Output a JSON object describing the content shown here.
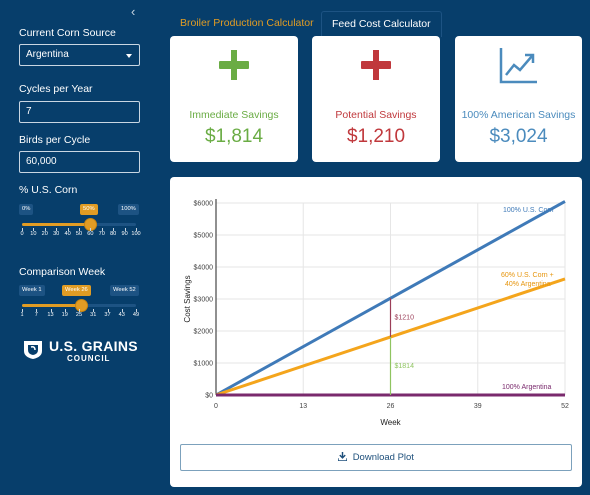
{
  "sidebar": {
    "collapse_glyph": "‹",
    "corn_source_label": "Current Corn Source",
    "corn_source_value": "Argentina",
    "cycles_label": "Cycles per Year",
    "cycles_value": "7",
    "birds_label": "Birds per Cycle",
    "birds_value": "60,000",
    "pct_label": "% U.S. Corn",
    "pct_presets": [
      "0%",
      "50%",
      "100%"
    ],
    "pct_ticks": [
      "0",
      "10",
      "20",
      "30",
      "40",
      "50",
      "60",
      "70",
      "80",
      "90",
      "100"
    ],
    "pct_value": 60,
    "week_label": "Comparison Week",
    "week_presets": [
      "Week 1",
      "Week 26",
      "Week 52"
    ],
    "week_ticks": [
      "1",
      "7",
      "13",
      "19",
      "25",
      "31",
      "37",
      "43",
      "49"
    ],
    "week_value": 26,
    "logo_line1": "U.S. GRAINS",
    "logo_line2": "COUNCIL"
  },
  "tabs": [
    {
      "label": "Broiler Production Calculator",
      "active": false
    },
    {
      "label": "Feed Cost Calculator",
      "active": true
    }
  ],
  "cards": [
    {
      "title": "Immediate Savings",
      "value": "$1,814",
      "color": "#6aac44",
      "icon": "plus-icon"
    },
    {
      "title": "Potential Savings",
      "value": "$1,210",
      "color": "#c0383c",
      "icon": "minus-plus-icon"
    },
    {
      "title": "100% American Savings",
      "value": "$3,024",
      "color": "#4b8bbd",
      "icon": "trend-up-icon"
    }
  ],
  "download_label": "Download Plot",
  "chart_data": {
    "type": "line",
    "xlabel": "Week",
    "ylabel": "Cost Savings",
    "xlim": [
      0,
      52
    ],
    "ylim": [
      0,
      6000
    ],
    "x_ticks": [
      "0",
      "13",
      "26",
      "39",
      "52"
    ],
    "y_ticks": [
      "$0",
      "$1000",
      "$2000",
      "$3000",
      "$4000",
      "$5000",
      "$6000"
    ],
    "series": [
      {
        "name": "100% U.S. Corn",
        "color": "#3f7ab8",
        "x": [
          0,
          52
        ],
        "y": [
          0,
          6048
        ]
      },
      {
        "name": "60% U.S. Corn + 40% Argentina",
        "color": "#f4a51c",
        "x": [
          0,
          52
        ],
        "y": [
          0,
          3628
        ]
      },
      {
        "name": "100% Argentina",
        "color": "#7a2a6d",
        "x": [
          0,
          52
        ],
        "y": [
          0,
          0
        ]
      }
    ],
    "annotations": [
      {
        "label": "$1210",
        "color": "#9b3e58",
        "x": 26,
        "y_from": 1814,
        "y_to": 3024
      },
      {
        "label": "$1814",
        "color": "#8fc460",
        "x": 26,
        "y_from": 0,
        "y_to": 1814
      }
    ]
  }
}
